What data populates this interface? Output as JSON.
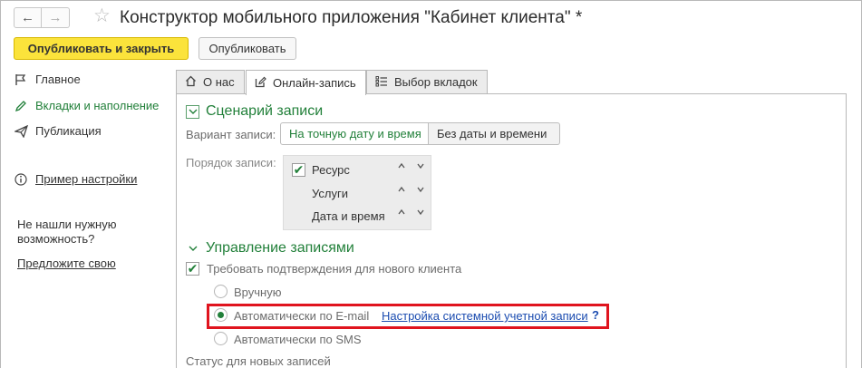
{
  "window": {
    "title": "Конструктор мобильного приложения \"Кабинет клиента\" *",
    "back_glyph": "←",
    "forward_glyph": "→",
    "star_glyph": "☆"
  },
  "toolbar": {
    "publish_close_label": "Опубликовать и закрыть",
    "publish_label": "Опубликовать"
  },
  "sidebar": {
    "items": [
      {
        "label": "Главное",
        "icon": "flag-icon"
      },
      {
        "label": "Вкладки и наполнение",
        "icon": "pencil-icon"
      },
      {
        "label": "Публикация",
        "icon": "send-icon"
      }
    ],
    "example_link": "Пример настройки",
    "help_text_1": "Не нашли нужную",
    "help_text_2": "возможность?",
    "suggest_link": "Предложите свою"
  },
  "tabs": [
    {
      "label": "О нас",
      "icon": "home-icon"
    },
    {
      "label": "Онлайн-запись",
      "icon": "edit-icon",
      "active": true
    },
    {
      "label": "Выбор вкладок",
      "icon": "list-icon"
    }
  ],
  "booking": {
    "group_title": "Сценарий записи",
    "variant_label": "Вариант записи:",
    "variant_options": [
      "На точную дату и время",
      "Без даты и времени"
    ],
    "variant_selected": "На точную дату и время",
    "order_label": "Порядок записи:",
    "order_items": [
      {
        "label": "Ресурс",
        "checked": true
      },
      {
        "label": "Услуги",
        "checked": false
      },
      {
        "label": "Дата и время",
        "checked": false
      }
    ],
    "up_glyph": "⌃",
    "down_glyph": "⌄"
  },
  "management": {
    "group_title": "Управление записями",
    "confirm_label": "Требовать подтверждения для нового клиента",
    "confirm_checked": true,
    "radio_options": [
      {
        "label": "Вручную",
        "selected": false
      },
      {
        "label": "Автоматически по E-mail",
        "selected": true
      },
      {
        "label": "Автоматически по SMS",
        "selected": false
      }
    ],
    "account_link": "Настройка системной учетной записи",
    "help_glyph": "?",
    "status_label": "Статус для новых записей"
  },
  "colors": {
    "accent_green": "#22803a",
    "primary_button": "#fbe33b",
    "link_blue": "#1b4cb0",
    "highlight_red": "#e0141e"
  }
}
